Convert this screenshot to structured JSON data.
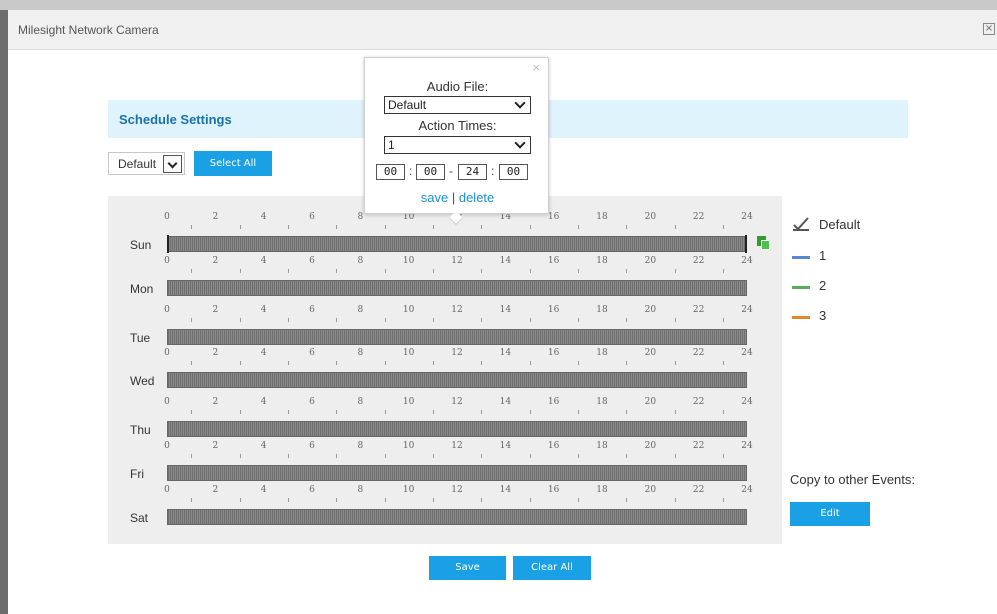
{
  "window": {
    "title": "Milesight Network Camera",
    "close_glyph": "×"
  },
  "section": {
    "title": "Schedule Settings"
  },
  "template_select": {
    "value": "Default"
  },
  "buttons": {
    "select_all": "Select All",
    "edit": "Edit",
    "save": "Save",
    "clear_all": "Clear All"
  },
  "ticks": [
    "0",
    "2",
    "4",
    "6",
    "8",
    "10",
    "12",
    "14",
    "16",
    "18",
    "20",
    "22",
    "24"
  ],
  "days": [
    "Sun",
    "Mon",
    "Tue",
    "Wed",
    "Thu",
    "Fri",
    "Sat"
  ],
  "legend": [
    {
      "label": "Default",
      "icon": "check-icon"
    },
    {
      "label": "1",
      "color": "#5b86d6"
    },
    {
      "label": "2",
      "color": "#5aaa5a"
    },
    {
      "label": "3",
      "color": "#e08a2e"
    }
  ],
  "copy_label": "Copy to other Events:",
  "popup": {
    "audio_label": "Audio File:",
    "audio_value": "Default",
    "times_label": "Action Times:",
    "times_value": "1",
    "start_h": "00",
    "start_m": "00",
    "end_h": "24",
    "end_m": "00",
    "save": "save",
    "separator": "|",
    "delete": "delete",
    "close_glyph": "×"
  },
  "colors": {
    "accent": "#1aa0e4",
    "header_bg": "#dff3fd",
    "title_color": "#1a73a8",
    "bar": "#7a7a7a"
  }
}
